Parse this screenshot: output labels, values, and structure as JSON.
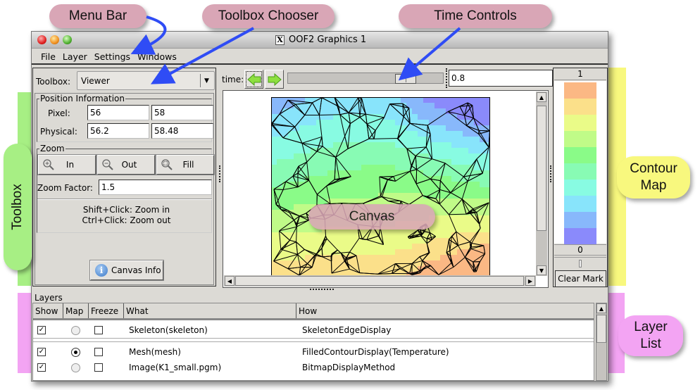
{
  "callouts": {
    "menu_bar": "Menu Bar",
    "toolbox_chooser": "Toolbox Chooser",
    "time_controls": "Time Controls",
    "toolbox": "Toolbox",
    "contour_map": "Contour Map",
    "canvas": "Canvas",
    "layer_list": "Layer List"
  },
  "window": {
    "title": "OOF2 Graphics 1",
    "title_icon": "x11-icon"
  },
  "menubar": {
    "items": [
      "File",
      "Layer",
      "Settings",
      "Windows"
    ]
  },
  "toolbox": {
    "label": "Toolbox:",
    "selected": "Viewer",
    "position_info": {
      "title": "Position Information",
      "pixel_label": "Pixel:",
      "pixel_x": "56",
      "pixel_y": "58",
      "physical_label": "Physical:",
      "physical_x": "56.2",
      "physical_y": "58.48"
    },
    "zoom": {
      "title": "Zoom",
      "in_label": "In",
      "out_label": "Out",
      "fill_label": "Fill",
      "factor_label": "Zoom Factor:",
      "factor_value": "1.5",
      "hint_line1": "Shift+Click: Zoom in",
      "hint_line2": "Ctrl+Click: Zoom out"
    },
    "canvas_info_label": "Canvas Info"
  },
  "time": {
    "label": "time:",
    "value": "0.8",
    "slider_fraction": 0.8
  },
  "contour_map": {
    "max_label": "1",
    "min_label": "0",
    "colors": [
      "#fbb884",
      "#fbe08a",
      "#eafb88",
      "#c0fb88",
      "#8afb88",
      "#88fbb4",
      "#88fbe2",
      "#88e4fb",
      "#88b8fb",
      "#8a8afb"
    ],
    "clear_mark_label": "Clear Mark"
  },
  "layers": {
    "title": "Layers",
    "columns": [
      "Show",
      "Map",
      "Freeze",
      "What",
      "How"
    ],
    "rows": [
      {
        "show": true,
        "map": false,
        "freeze": false,
        "what": "Skeleton(skeleton)",
        "how": "SkeletonEdgeDisplay"
      },
      {
        "show": true,
        "map": true,
        "freeze": false,
        "what": "Mesh(mesh)",
        "how": "FilledContourDisplay(Temperature)"
      },
      {
        "show": true,
        "map": false,
        "freeze": false,
        "what": "Image(K1_small.pgm)",
        "how": "BitmapDisplayMethod"
      }
    ]
  },
  "colors": {
    "callout_pink": "#d9a6b6",
    "callout_yellow": "#f8f87e",
    "callout_green": "#a7ef84",
    "callout_magenta": "#f3a4f3",
    "arrow_blue": "#2f4cf5",
    "window_bg": "#dcdad5"
  }
}
